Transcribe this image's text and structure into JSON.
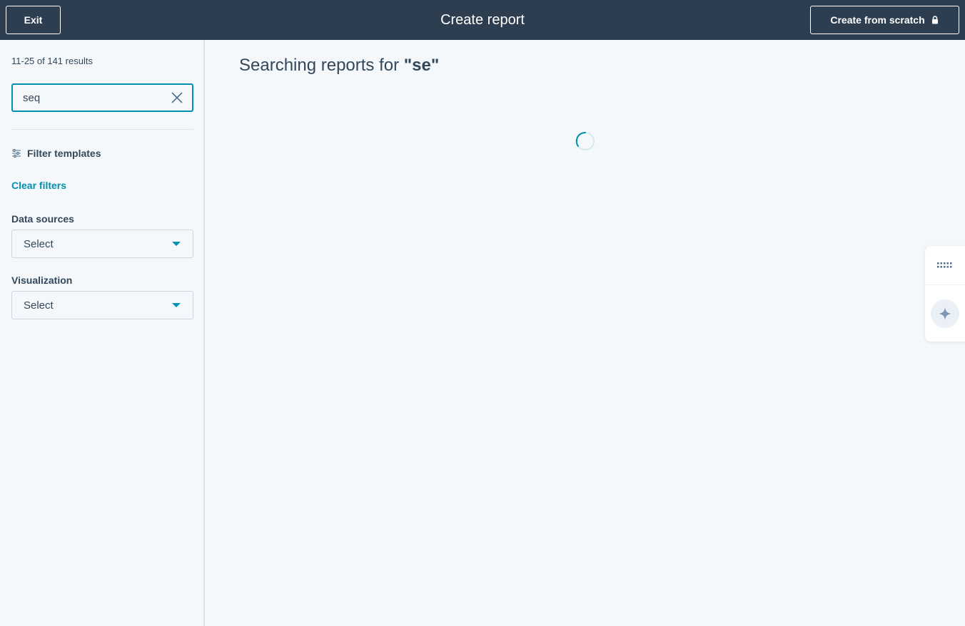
{
  "topbar": {
    "exit_label": "Exit",
    "title": "Create report",
    "create_from_scratch_label": "Create from scratch"
  },
  "sidebar": {
    "results_count": "11-25 of 141 results",
    "search_value": "seq",
    "filter_templates_label": "Filter templates",
    "clear_filters_label": "Clear filters",
    "data_sources": {
      "label": "Data sources",
      "selected": "Select"
    },
    "visualization": {
      "label": "Visualization",
      "selected": "Select"
    }
  },
  "main": {
    "heading_prefix": "Searching reports for ",
    "heading_query": "\"se\""
  },
  "colors": {
    "topbar_bg": "#2d3e50",
    "accent": "#0091ae",
    "text": "#33475b",
    "page_bg": "#f5f8fa"
  },
  "icons": {
    "lock": "lock-icon",
    "clear": "close-icon",
    "filter": "sliders-icon",
    "spinner": "loading-spinner-icon",
    "grid": "grid-dots-icon",
    "ai": "sparkle-icon"
  }
}
